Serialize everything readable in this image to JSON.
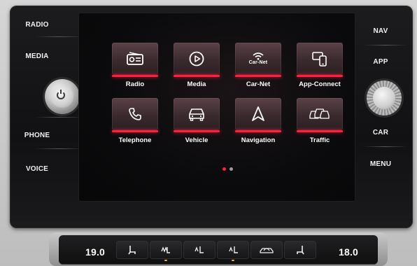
{
  "hardware_buttons": {
    "left": [
      "RADIO",
      "MEDIA",
      "PHONE",
      "VOICE"
    ],
    "right": [
      "NAV",
      "APP",
      "CAR",
      "MENU"
    ]
  },
  "apps": [
    {
      "label": "Radio",
      "icon": "radio-icon"
    },
    {
      "label": "Media",
      "icon": "play-icon"
    },
    {
      "label": "Car-Net",
      "icon": "wifi-icon",
      "icon_text": "Car-Net"
    },
    {
      "label": "App-Connect",
      "icon": "phone-connect-icon"
    },
    {
      "label": "Telephone",
      "icon": "phone-icon"
    },
    {
      "label": "Vehicle",
      "icon": "car-icon"
    },
    {
      "label": "Navigation",
      "icon": "navigation-arrow-icon"
    },
    {
      "label": "Traffic",
      "icon": "traffic-icon"
    }
  ],
  "pager": {
    "pages": 2,
    "current": 1
  },
  "climate": {
    "left_temp": "19.0",
    "right_temp": "18.0",
    "buttons": [
      "seat-heat-left-icon",
      "rear-defrost-icon",
      "seat-heat-icon",
      "seat-heat-right-icon",
      "recirculation-icon",
      "seat-heat-passenger-icon"
    ]
  },
  "colors": {
    "accent": "#ff1e3c",
    "tile": "#4a3439",
    "bezel": "#141416",
    "screen": "#0b0b0d"
  }
}
